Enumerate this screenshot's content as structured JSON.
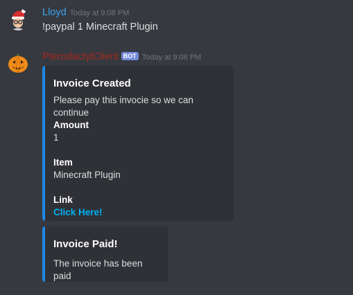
{
  "messages": [
    {
      "author": "Lloyd",
      "author_color": "#3ba5f0",
      "timestamp": "Today at 9:08 PM",
      "content": "!paypal 1 Minecraft Plugin"
    },
    {
      "author": "PterodactylClient",
      "author_color": "#a5281e",
      "bot_tag": "BOT",
      "timestamp": "Today at 9:08 PM"
    }
  ],
  "embeds": [
    {
      "title": "Invoice Created",
      "description": "Please pay this invocie so we can continue",
      "fields": [
        {
          "name": "Amount",
          "value": "1"
        },
        {
          "name": "Item",
          "value": "Minecraft Plugin"
        },
        {
          "name": "Link",
          "value": "Click Here!"
        }
      ],
      "accent": "#1e88e5"
    },
    {
      "title": "Invoice Paid!",
      "description": "The invoice has been paid",
      "accent": "#1e88e5"
    }
  ],
  "icons": [
    "santa-avatar-icon",
    "pumpkin-avatar-icon"
  ]
}
